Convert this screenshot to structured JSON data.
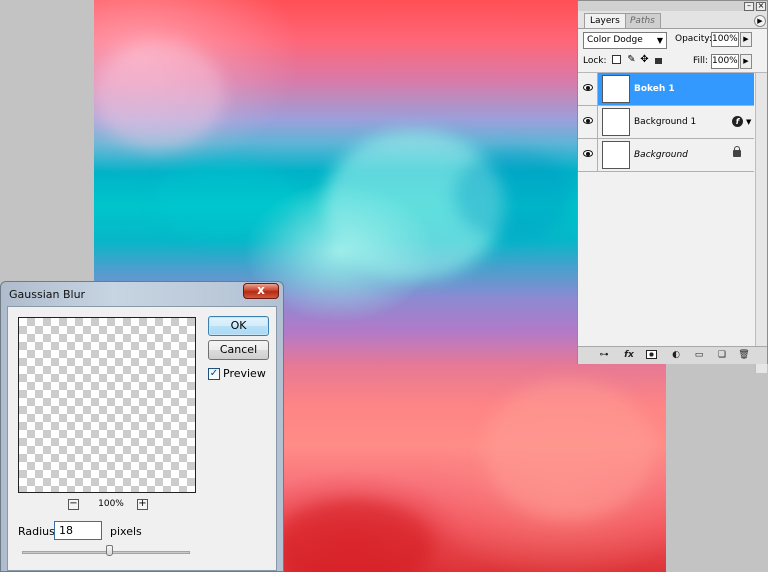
{
  "gaussian_blur": {
    "title": "Gaussian Blur",
    "close_label": "x",
    "ok_label": "OK",
    "cancel_label": "Cancel",
    "preview_label": "Preview",
    "preview_checked": true,
    "zoom_out": "−",
    "zoom_value": "100%",
    "zoom_in": "+",
    "radius_label": "Radius:",
    "radius_value": "18",
    "radius_unit": "pixels",
    "radius_slider_fraction": 0.52
  },
  "layers_panel": {
    "tabs": [
      "Layers",
      "Paths"
    ],
    "blend_mode": "Color Dodge",
    "opacity_label": "Opacity:",
    "opacity_value": "100%",
    "lock_label": "Lock:",
    "fill_label": "Fill:",
    "fill_value": "100%",
    "layers": [
      {
        "name": "Bokeh 1",
        "selected": true,
        "visible": true
      },
      {
        "name": "Background 1",
        "selected": false,
        "visible": true,
        "icon": "fx-icon"
      },
      {
        "name": "Background",
        "selected": false,
        "visible": true,
        "icon": "lock-icon"
      }
    ],
    "bottom_icons": [
      "link-icon",
      "fx-icon",
      "mask-icon",
      "adjustment-icon",
      "group-folder-icon",
      "new-layer-icon",
      "trash-icon"
    ]
  },
  "colors": {
    "selection_blue": "#3399ff",
    "canvas_cyan": "#00c5cb",
    "canvas_red": "#ff4f55"
  }
}
